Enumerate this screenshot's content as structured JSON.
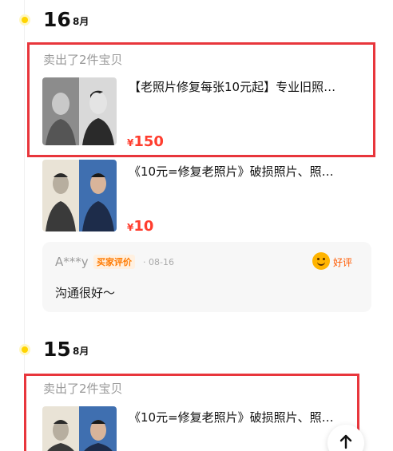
{
  "groups": [
    {
      "day": "16",
      "month": "8月",
      "sold_text": "卖出了2件宝贝",
      "items": [
        {
          "title": "【老照片修复每张10元起】专业旧照…",
          "currency": "¥",
          "price": "150",
          "thumb_icon": "old-photo-portrait-icon"
        },
        {
          "title": "《10元=修复老照片》破损照片、照…",
          "currency": "¥",
          "price": "10",
          "thumb_icon": "old-photo-portrait-icon"
        }
      ],
      "review": {
        "user": "A***y",
        "tag": "买家评价",
        "date": "· 08-16",
        "rating_icon": "smiley-icon",
        "rating": "好评",
        "text": "沟通很好〜"
      }
    },
    {
      "day": "15",
      "month": "8月",
      "sold_text": "卖出了2件宝贝",
      "items": [
        {
          "title": "《10元=修复老照片》破损照片、照…",
          "thumb_icon": "old-photo-portrait-icon"
        }
      ]
    }
  ],
  "back_to_top_icon": "arrow-up-icon",
  "colors": {
    "accent_yellow": "#ffd400",
    "price_red": "#ff3d2e",
    "highlight_frame": "#e8363c",
    "review_tag": "#ff7a00"
  }
}
